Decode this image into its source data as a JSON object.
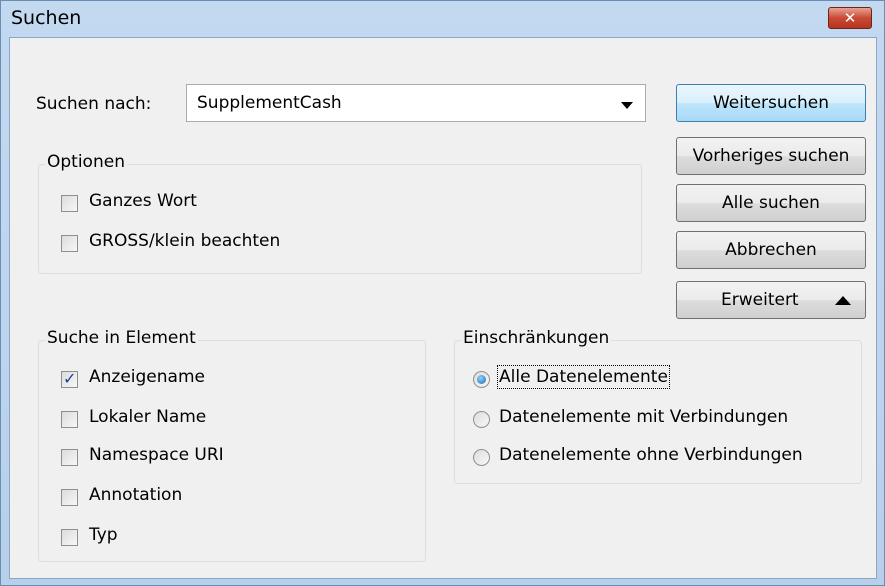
{
  "window": {
    "title": "Suchen",
    "close_label": "✕"
  },
  "search": {
    "label": "Suchen nach:",
    "value": "SupplementCash"
  },
  "buttons": {
    "find_next": "Weitersuchen",
    "find_prev": "Vorheriges suchen",
    "find_all": "Alle suchen",
    "cancel": "Abbrechen",
    "advanced": "Erweitert"
  },
  "options": {
    "title": "Optionen",
    "whole_word": {
      "label": "Ganzes Wort",
      "checked": false
    },
    "match_case": {
      "label": "GROSS/klein beachten",
      "checked": false
    }
  },
  "search_in": {
    "title": "Suche in Element",
    "items": [
      {
        "label": "Anzeigename",
        "checked": true
      },
      {
        "label": "Lokaler Name",
        "checked": false
      },
      {
        "label": "Namespace URI",
        "checked": false
      },
      {
        "label": "Annotation",
        "checked": false
      },
      {
        "label": "Typ",
        "checked": false
      }
    ]
  },
  "restrictions": {
    "title": "Einschränkungen",
    "items": [
      {
        "label": "Alle Datenelemente",
        "selected": true
      },
      {
        "label": "Datenelemente mit Verbindungen",
        "selected": false
      },
      {
        "label": "Datenelemente ohne Verbindungen",
        "selected": false
      }
    ]
  },
  "colors": {
    "titlebar": "#c3d9f0",
    "client": "#f0f0f0",
    "close": "#c84a35",
    "default_button": "#bee6fd"
  }
}
